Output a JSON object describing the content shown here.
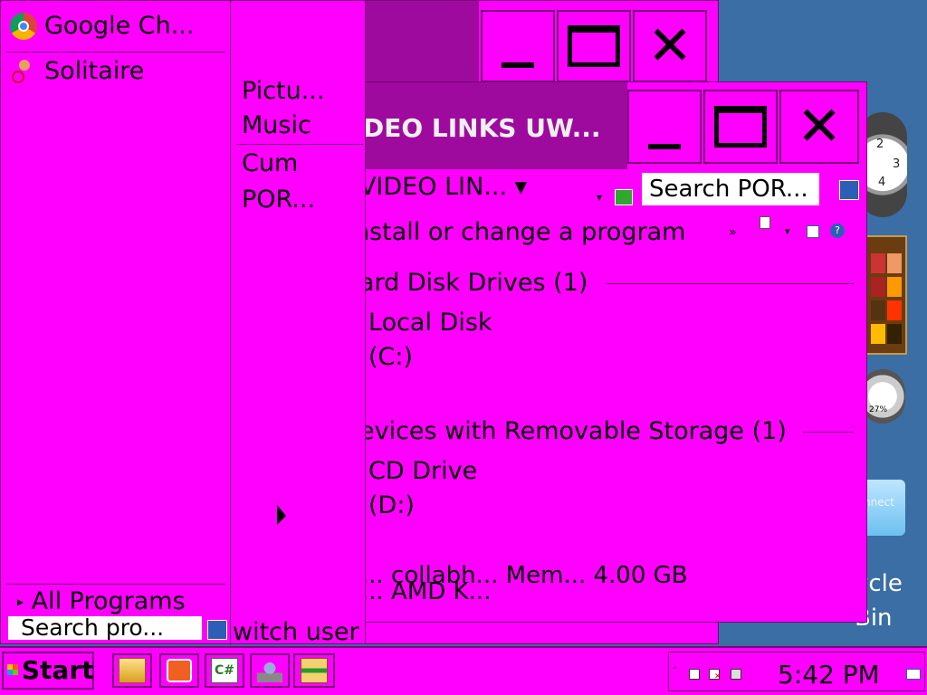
{
  "desktop": {
    "clock_numerals": [
      "2",
      "3",
      "4"
    ],
    "meter_label": "27%",
    "connect_label": "nnect",
    "recycle_bin_line1": "ycle",
    "recycle_bin_line2": "Bin"
  },
  "explorer": {
    "title": "DEO LINKS  UW...",
    "address": "VIDEO LIN... ▾",
    "search_placeholder": "Search POR...",
    "command": "nstall or change a program",
    "command_more": "»",
    "group_hdd": "ard Disk Drives (1)",
    "drive_c_name": "Local Disk",
    "drive_c_letter": "(C:)",
    "group_removable": "evices with Removable Storage (1)",
    "drive_d_name": "CD Drive",
    "drive_d_letter": "(D:)",
    "details_line1": "... collabh...  Mem... 4.00 GB",
    "details_line2": "... AMD K..."
  },
  "start_menu": {
    "pinned": [
      {
        "label": "Google Ch...",
        "icon": "chrome-icon"
      },
      {
        "label": "Solitaire",
        "icon": "solitaire-icon"
      }
    ],
    "right_items": [
      "Pictu...",
      "Music",
      "Cum",
      "POR..."
    ],
    "all_programs": "All Programs",
    "search_placeholder": "Search pro...",
    "switch_user": "witch user"
  },
  "taskbar": {
    "start_label": "Start",
    "clock": "5:42 PM",
    "apps": [
      "explorer-icon",
      "media-player-icon",
      "csharp-icon",
      "network-icon",
      "archive-icon"
    ]
  },
  "colors": {
    "accent": "#ff00ff",
    "title_active": "#9e0a9e",
    "border": "#7a007a"
  }
}
